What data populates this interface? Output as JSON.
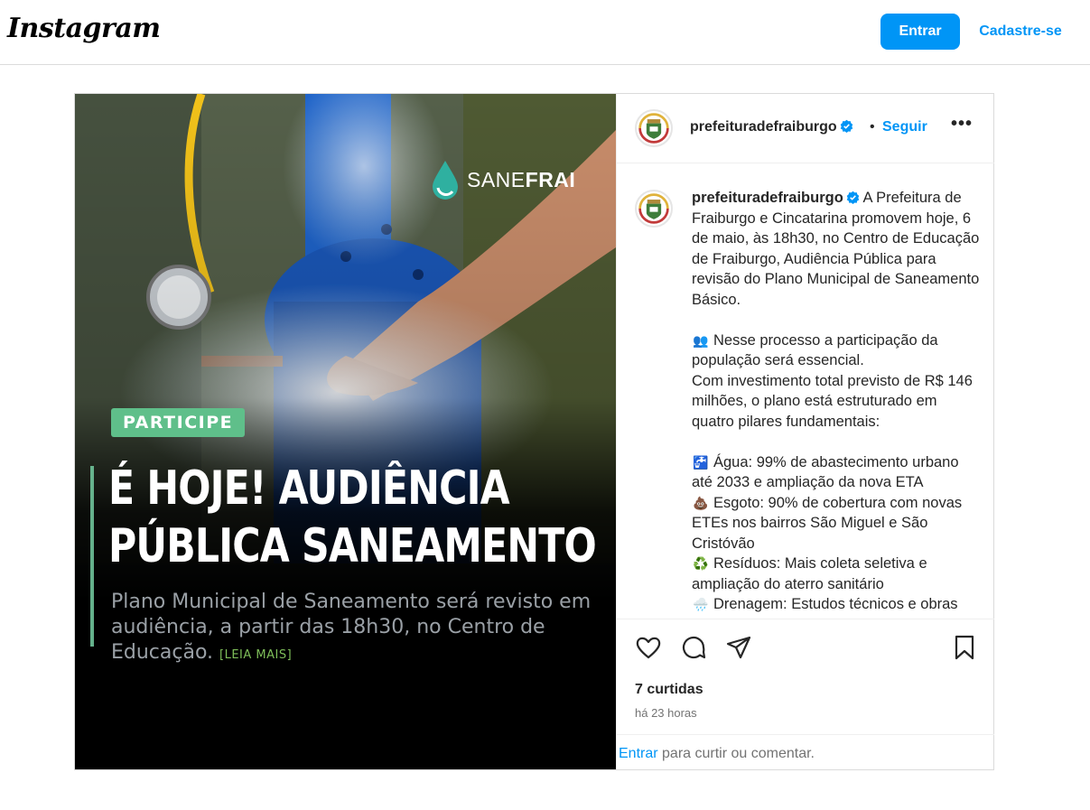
{
  "header": {
    "logo": "Instagram",
    "login_label": "Entrar",
    "signup_label": "Cadastre-se"
  },
  "media": {
    "brand_prefix": "SANE",
    "brand_suffix": "FRAI",
    "tag": "PARTICIPE",
    "headline_line1": "É HOJE! AUDIÊNCIA",
    "headline_line2": "PÚBLICA SANEAMENTO",
    "subtext": "Plano Municipal de Saneamento será revisto em audiência, a partir das 18h30, no Centro de Educação.",
    "readmore": "[LEIA MAIS]"
  },
  "post_header": {
    "username": "prefeituradefraiburgo",
    "separator": "•",
    "follow_label": "Seguir",
    "more_label": "•••"
  },
  "caption": {
    "username": "prefeituradefraiburgo",
    "intro": "A Prefeitura de Fraiburgo e Cincatarina promovem hoje, 6 de maio, às 18h30, no Centro de Educação de Fraiburgo, Audiência Pública para revisão do Plano Municipal de Saneamento Básico.",
    "para2_line1": "Nesse processo a participação da população será essencial.",
    "para2_line2": "Com investimento total previsto de R$ 146 milhões, o plano está estruturado em quatro pilares fundamentais:",
    "items": [
      {
        "emoji": "🚰",
        "text": "Água: 99% de abastecimento urbano até 2033 e ampliação da nova ETA"
      },
      {
        "emoji": "💩",
        "text": "Esgoto: 90% de cobertura com novas ETEs nos bairros São Miguel e São Cristóvão"
      },
      {
        "emoji": "♻️",
        "text": "Resíduos: Mais coleta seletiva e ampliação do aterro sanitário"
      },
      {
        "emoji": "🌧️",
        "text": "Drenagem: Estudos técnicos e obras"
      }
    ],
    "people_emoji": "👥"
  },
  "engagement": {
    "likes": "7 curtidas",
    "time": "há 23 horas"
  },
  "login_prompt": {
    "link": "Entrar",
    "text": " para curtir ou comentar."
  }
}
